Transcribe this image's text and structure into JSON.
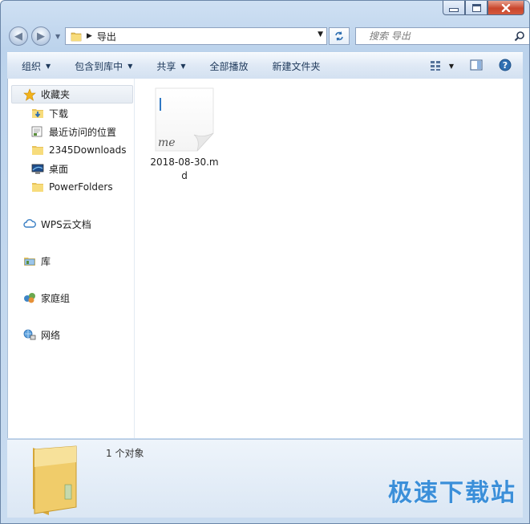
{
  "window": {
    "controls": {
      "minimize": "minimize-icon",
      "maximize": "maximize-icon",
      "close": "close-icon"
    }
  },
  "address_bar": {
    "path_segments": [
      "导出"
    ],
    "search_placeholder": "搜索 导出"
  },
  "toolbar": {
    "organize": "组织",
    "include_in_library": "包含到库中",
    "share": "共享",
    "play_all": "全部播放",
    "new_folder": "新建文件夹"
  },
  "nav": {
    "favorites": {
      "label": "收藏夹",
      "items": [
        {
          "label": "下载",
          "icon": "download-folder-icon"
        },
        {
          "label": "最近访问的位置",
          "icon": "recent-places-icon"
        },
        {
          "label": "2345Downloads",
          "icon": "folder-icon"
        },
        {
          "label": "桌面",
          "icon": "desktop-icon"
        },
        {
          "label": "PowerFolders",
          "icon": "folder-icon"
        }
      ]
    },
    "wps_cloud": "WPS云文档",
    "libraries": "库",
    "homegroup": "家庭组",
    "network": "网络"
  },
  "files": [
    {
      "name": "2018-08-30.md",
      "thumb_text": "me",
      "icon": "markdown-file-icon"
    }
  ],
  "details": {
    "count_text": "1 个对象"
  },
  "watermark": "极速下载站",
  "colors": {
    "window_frame": "#c9dcf0",
    "close_button": "#c9462c",
    "watermark": "#3b8fd9",
    "help": "#2f6fb2"
  }
}
